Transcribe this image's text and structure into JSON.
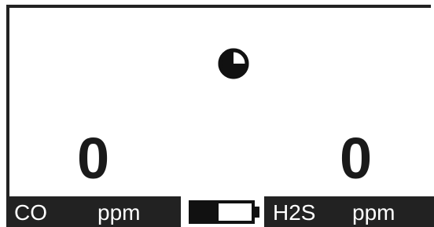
{
  "indicators": {
    "timer_icon": "pie-timer-icon",
    "battery_icon": "battery-icon",
    "battery_level": 0.45
  },
  "readings": [
    {
      "value": "0"
    },
    {
      "value": "0"
    }
  ],
  "status_bar": {
    "left_gas": "CO",
    "left_unit": "ppm",
    "right_gas": "H2S",
    "right_unit": "ppm"
  }
}
